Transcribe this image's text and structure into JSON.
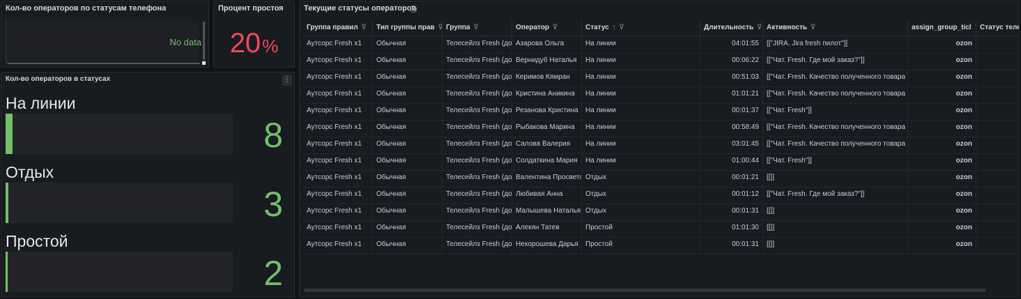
{
  "panel_phone_status": {
    "title": "Кол-во операторов по статусам телефона",
    "no_data_text": "No data"
  },
  "panel_idle": {
    "title": "Процент простоя",
    "value": "20",
    "unit": "%",
    "color": "#f2495c"
  },
  "panel_status_counts": {
    "title": "Кол-во операторов в статусах",
    "menu_icon": "vertical-dots-icon",
    "groups": [
      {
        "label": "На линии",
        "value": "8"
      },
      {
        "label": "Отдых",
        "value": "3"
      },
      {
        "label": "Простой",
        "value": "2"
      }
    ],
    "color": "#73bf69"
  },
  "panel_table": {
    "title": "Текущие статусы операторов",
    "info_icon": "info-icon",
    "columns": [
      "Группа правил",
      "Тип группы прав",
      "Группа",
      "Оператор",
      "Статус",
      "Длительность",
      "Активность",
      "assign_group_ticl",
      "Статус теле"
    ],
    "rows": [
      [
        "Аутсорс Fresh x1",
        "Обычная",
        "Телесейлз Fresh (до",
        "Азарова Ольга",
        "На линии",
        "04:01:55",
        "[[\"JIRA. Jira fresh пилот\"]]",
        "ozon",
        ""
      ],
      [
        "Аутсорс Fresh x1",
        "Обычная",
        "Телесейлз Fresh (до",
        "Вернидуб Наталья",
        "На линии",
        "00:06:22",
        "[[\"Чат. Fresh. Где мой заказ?\"]]",
        "ozon",
        ""
      ],
      [
        "Аутсорс Fresh x1",
        "Обычная",
        "Телесейлз Fresh (до",
        "Керимов Кямран",
        "На линии",
        "00:51:03",
        "[[\"Чат. Fresh. Качество полученного товара",
        "ozon",
        ""
      ],
      [
        "Аутсорс Fresh x1",
        "Обычная",
        "Телесейлз Fresh (до",
        "Кристина Аникина",
        "На линии",
        "01:01:21",
        "[[\"Чат. Fresh. Качество полученного товара",
        "ozon",
        ""
      ],
      [
        "Аутсорс Fresh x1",
        "Обычная",
        "Телесейлз Fresh (до",
        "Резанова Кристина",
        "На линии",
        "00:01:37",
        "[[\"Чат. Fresh\"]]",
        "ozon",
        ""
      ],
      [
        "Аутсорс Fresh x1",
        "Обычная",
        "Телесейлз Fresh (до",
        "Рыбакова Марина",
        "На линии",
        "00:58:49",
        "[[\"Чат. Fresh. Качество полученного товара",
        "ozon",
        ""
      ],
      [
        "Аутсорс Fresh x1",
        "Обычная",
        "Телесейлз Fresh (до",
        "Салова Валерия",
        "На линии",
        "03:01:45",
        "[[\"Чат. Fresh. Качество полученного товара",
        "ozon",
        ""
      ],
      [
        "Аутсорс Fresh x1",
        "Обычная",
        "Телесейлз Fresh (до",
        "Солдаткина Мария",
        "На линии",
        "01:00:44",
        "[[\"Чат. Fresh\"]]",
        "ozon",
        ""
      ],
      [
        "Аутсорс Fresh x1",
        "Обычная",
        "Телесейлз Fresh (до",
        "Валентина Просвето",
        "Отдых",
        "00:01:21",
        "[[]]",
        "ozon",
        ""
      ],
      [
        "Аутсорс Fresh x1",
        "Обычная",
        "Телесейлз Fresh (до",
        "Любивая Анна",
        "Отдых",
        "00:01:12",
        "[[\"Чат. Fresh. Где мой заказ?\"]]",
        "ozon",
        ""
      ],
      [
        "Аутсорс Fresh x1",
        "Обычная",
        "Телесейлз Fresh (до",
        "Малышева Наталья",
        "Отдых",
        "00:01:31",
        "[[]]",
        "ozon",
        ""
      ],
      [
        "Аутсорс Fresh x1",
        "Обычная",
        "Телесейлз Fresh (до",
        "Алекян Татев",
        "Простой",
        "01:01:30",
        "[[]]",
        "ozon",
        ""
      ],
      [
        "Аутсорс Fresh x1",
        "Обычная",
        "Телесейлз Fresh (до",
        "Нехорошева Дарья",
        "Простой",
        "00:01:31",
        "[[]]",
        "ozon",
        ""
      ]
    ],
    "sort_column": "Статус",
    "sort_icon": "sort-ascending-icon",
    "filter_icon": "filter-icon"
  }
}
